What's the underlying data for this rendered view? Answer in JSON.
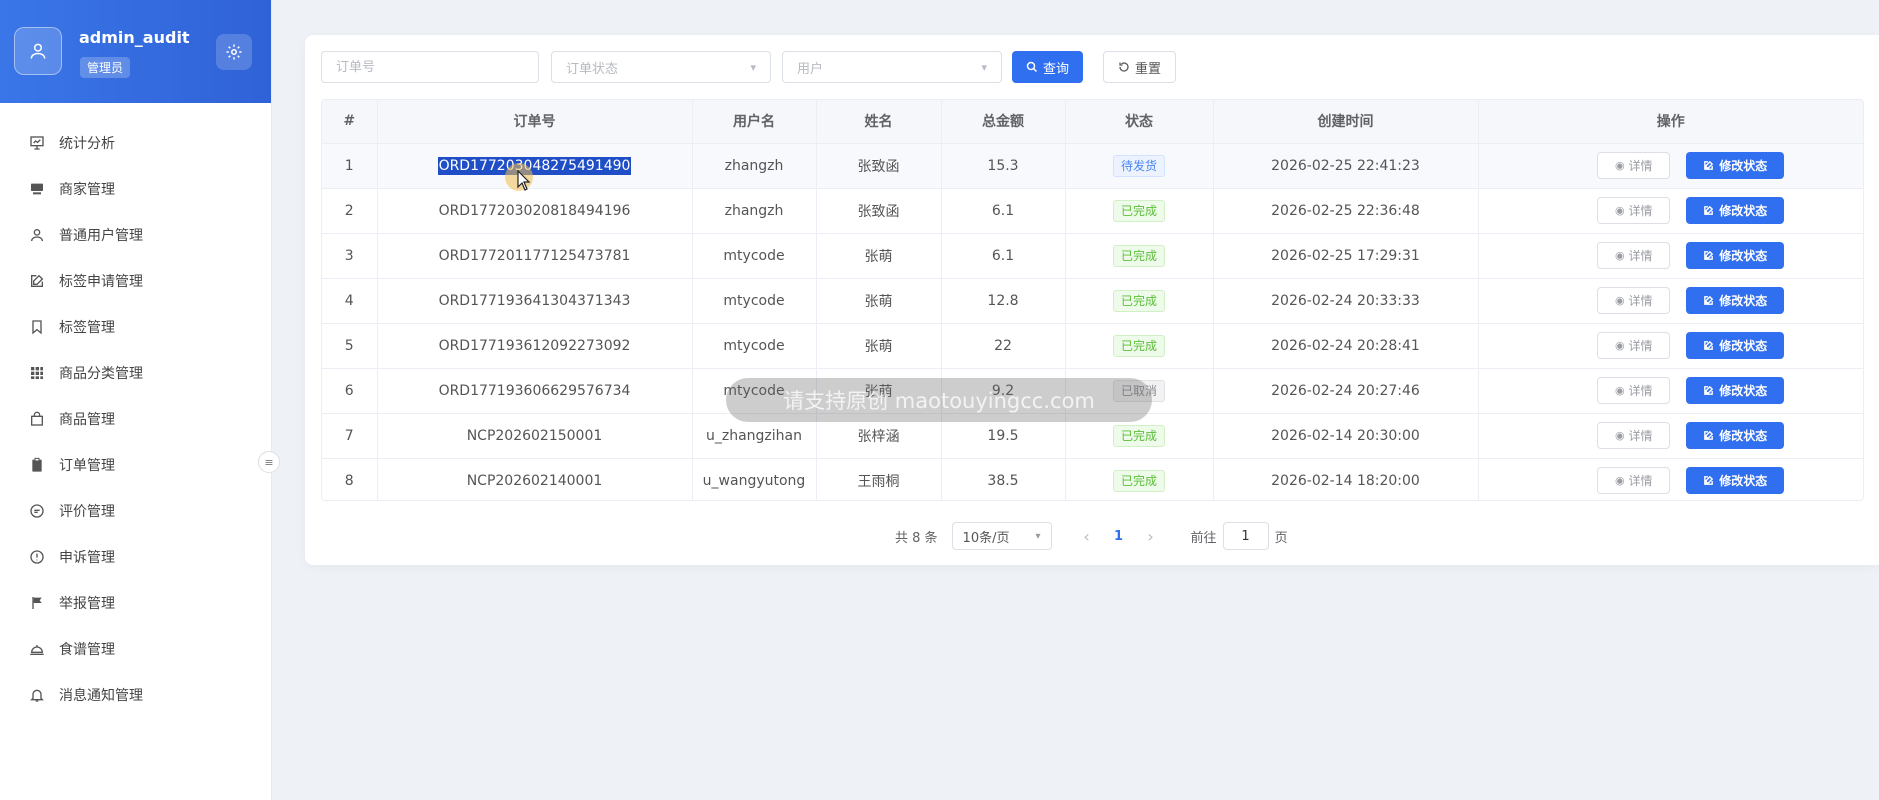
{
  "sidebar": {
    "user_name": "admin_audit",
    "role": "管理员",
    "items": [
      {
        "label": "统计分析",
        "icon": "chart-board-icon"
      },
      {
        "label": "商家管理",
        "icon": "store-icon"
      },
      {
        "label": "普通用户管理",
        "icon": "user-icon"
      },
      {
        "label": "标签申请管理",
        "icon": "edit-icon"
      },
      {
        "label": "标签管理",
        "icon": "bookmark-icon"
      },
      {
        "label": "商品分类管理",
        "icon": "grid-icon"
      },
      {
        "label": "商品管理",
        "icon": "bag-icon"
      },
      {
        "label": "订单管理",
        "icon": "clipboard-icon"
      },
      {
        "label": "评价管理",
        "icon": "chat-icon"
      },
      {
        "label": "申诉管理",
        "icon": "warning-icon"
      },
      {
        "label": "举报管理",
        "icon": "flag-icon"
      },
      {
        "label": "食谱管理",
        "icon": "cloche-icon"
      },
      {
        "label": "消息通知管理",
        "icon": "bell-icon"
      }
    ],
    "collapse_symbol": "≡"
  },
  "filters": {
    "order_no_placeholder": "订单号",
    "status_placeholder": "订单状态",
    "user_placeholder": "用户",
    "search_label": "查询",
    "reset_label": "重置"
  },
  "table": {
    "headers": [
      "#",
      "订单号",
      "用户名",
      "姓名",
      "总金额",
      "状态",
      "创建时间",
      "操作"
    ],
    "detail_label": "详情",
    "modify_label": "修改状态",
    "rows": [
      {
        "idx": "1",
        "order_no": "ORD1772030482754914​90",
        "username": "zhangzh",
        "name": "张致函",
        "amount": "15.3",
        "status": "待发货",
        "status_type": "pending",
        "created": "2026-02-25 22:41:23"
      },
      {
        "idx": "2",
        "order_no": "ORD177203020818494196",
        "username": "zhangzh",
        "name": "张致函",
        "amount": "6.1",
        "status": "已完成",
        "status_type": "done",
        "created": "2026-02-25 22:36:48"
      },
      {
        "idx": "3",
        "order_no": "ORD177201177125473781",
        "username": "mtycode",
        "name": "张萌",
        "amount": "6.1",
        "status": "已完成",
        "status_type": "done",
        "created": "2026-02-25 17:29:31"
      },
      {
        "idx": "4",
        "order_no": "ORD177193641304371343",
        "username": "mtycode",
        "name": "张萌",
        "amount": "12.8",
        "status": "已完成",
        "status_type": "done",
        "created": "2026-02-24 20:33:33"
      },
      {
        "idx": "5",
        "order_no": "ORD177193612092273092",
        "username": "mtycode",
        "name": "张萌",
        "amount": "22",
        "status": "已完成",
        "status_type": "done",
        "created": "2026-02-24 20:28:41"
      },
      {
        "idx": "6",
        "order_no": "ORD177193606629576734",
        "username": "mtycode",
        "name": "张萌",
        "amount": "9.2",
        "status": "已取消",
        "status_type": "cancel",
        "created": "2026-02-24 20:27:46"
      },
      {
        "idx": "7",
        "order_no": "NCP202602150001",
        "username": "u_zhangzihan",
        "name": "张梓涵",
        "amount": "19.5",
        "status": "已完成",
        "status_type": "done",
        "created": "2026-02-14 20:30:00"
      },
      {
        "idx": "8",
        "order_no": "NCP202602140001",
        "username": "u_wangyutong",
        "name": "王雨桐",
        "amount": "38.5",
        "status": "已完成",
        "status_type": "done",
        "created": "2026-02-14 18:20:00"
      }
    ]
  },
  "pagination": {
    "total_text": "共 8 条",
    "page_size": "10条/页",
    "current_page": "1",
    "goto_label": "前往",
    "goto_value": "1",
    "page_suffix": "页"
  },
  "watermark": "请支持原创 maotouyingcc.com",
  "colors": {
    "primary": "#2f6ff0",
    "header_gradient_start": "#3a76e8",
    "done_green": "#5cbf3a",
    "pending_blue": "#4a84f0"
  }
}
